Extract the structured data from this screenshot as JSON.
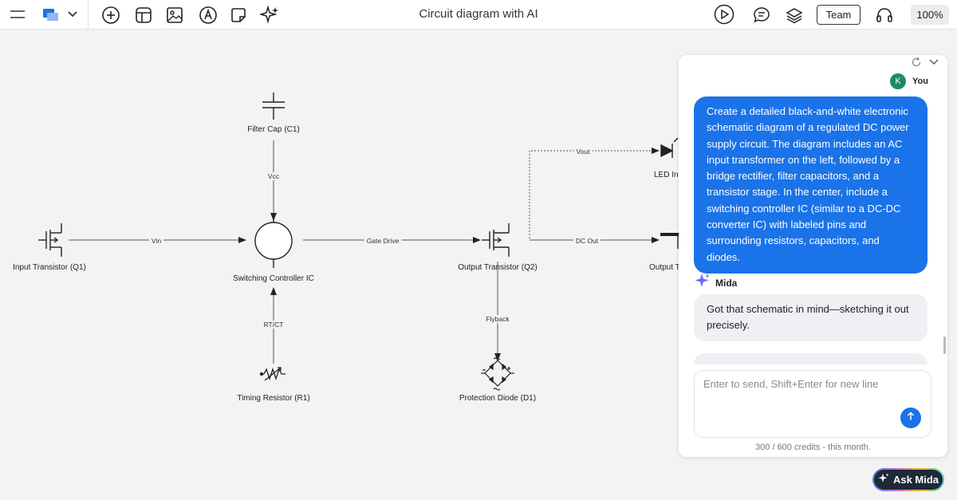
{
  "toolbar": {
    "title": "Circuit diagram with AI",
    "team_label": "Team",
    "zoom": "100%",
    "icons": [
      "menu-icon",
      "layers-logo-icon",
      "chevron-down-icon",
      "add-icon",
      "template-icon",
      "image-icon",
      "pen-icon",
      "sticky-note-icon",
      "ai-sparkle-icon",
      "play-icon",
      "comment-icon",
      "layers-icon",
      "headset-icon"
    ]
  },
  "diagram": {
    "nodes": {
      "q1": "Input Transistor (Q1)",
      "c1": "Filter Cap (C1)",
      "ic": "Switching Controller IC",
      "r1": "Timing Resistor (R1)",
      "q2": "Output Transistor (Q2)",
      "d1": "Protection Diode (D1)",
      "led": "LED Inc",
      "out": "Output Te"
    },
    "edges": {
      "vin": "Vin",
      "vcc": "Vcc",
      "rtct": "RT/CT",
      "gate": "Gate Drive",
      "dcout": "DC Out",
      "vout": "Vout",
      "flyback": "Flyback"
    }
  },
  "chat": {
    "user_initial": "K",
    "user_name": "You",
    "user_message": "Create a detailed black-and-white electronic schematic diagram of a regulated DC power supply circuit. The diagram includes an AC input transformer on the left, followed by a bridge rectifier, filter capacitors, and a transistor stage. In the center, include a switching controller IC (similar to a DC-DC converter IC) with labeled pins and surrounding resistors, capacitors, and diodes.",
    "assistant_name": "Mida",
    "assistant_message": "Got that schematic in mind—sketching it out precisely.",
    "input_placeholder": "Enter to send, Shift+Enter for new line",
    "credits": "300 / 600 credits - this month."
  },
  "ask_button": "Ask Mida",
  "colors": {
    "accent": "#1a73e8",
    "avatar": "#1d8a6b",
    "canvas": "#f3f3f3"
  }
}
